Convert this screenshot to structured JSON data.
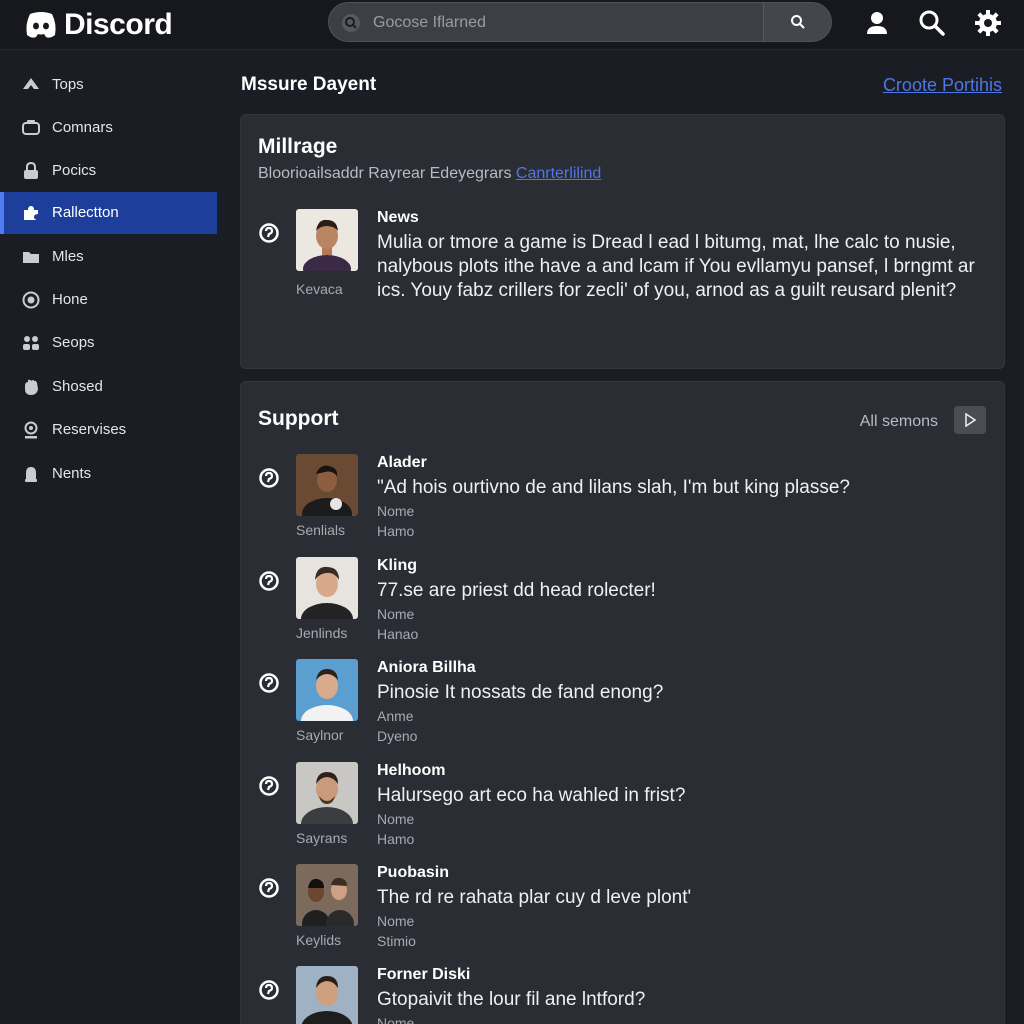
{
  "app": {
    "name": "Discord"
  },
  "search": {
    "placeholder": "Gocose Iflarned"
  },
  "sidebar": {
    "items": [
      {
        "label": "Tops",
        "icon": "up-arrow-icon"
      },
      {
        "label": "Comnars",
        "icon": "chat-icon"
      },
      {
        "label": "Pocics",
        "icon": "lock-icon"
      },
      {
        "label": "Rallectton",
        "icon": "puzzle-icon",
        "active": true
      },
      {
        "label": "Mles",
        "icon": "folder-icon"
      },
      {
        "label": "Hone",
        "icon": "circle-icon"
      },
      {
        "label": "Seops",
        "icon": "group-icon"
      },
      {
        "label": "Shosed",
        "icon": "hand-icon"
      },
      {
        "label": "Reservises",
        "icon": "pin-icon"
      },
      {
        "label": "Nents",
        "icon": "bell-icon"
      }
    ]
  },
  "main": {
    "title": "Mssure Dayent",
    "action_link": "Croote Portihis"
  },
  "card1": {
    "title": "Millrage",
    "subtitle": "Bloorioailsaddr Rayrear Edeyegrars",
    "subtitle_link": "Canrterlilind",
    "post": {
      "author": "News",
      "text": "Mulia or tmore a game is Dread l ead l bitumg, mat, lhe calc to nusie, nalybous plots ithe have a and lcam if You evllamyu pansef, l brngmt ar ics. Youy fabz crillers for zecli' of you, arnod as a guilt reusard plenit?",
      "handle": "Kevaca"
    }
  },
  "card2": {
    "title": "Support",
    "all_link": "All semons",
    "posts": [
      {
        "author": "Alader",
        "text": "\"Ad hois ourtivno de and lilans slah, I'm but king plasse?",
        "meta1": "Nome",
        "meta2": "Hamo",
        "handle": "Senlials"
      },
      {
        "author": "Kling",
        "text": "77.se are priest dd head rolecter!",
        "meta1": "Nome",
        "meta2": "Hanao",
        "handle": "Jenlinds"
      },
      {
        "author": "Aniora Billha",
        "text": "Pinosie It nossats de fand enong?",
        "meta1": "Anme",
        "meta2": "Dyeno",
        "handle": "Saylnor"
      },
      {
        "author": "Helhoom",
        "text": "Halursego art eco ha wahled in frist?",
        "meta1": "Nome",
        "meta2": "Hamo",
        "handle": "Sayrans"
      },
      {
        "author": "Puobasin",
        "text": "The rd re rahata plar cuy d leve plont'",
        "meta1": "Nome",
        "meta2": "Stimio",
        "handle": "Keylids"
      },
      {
        "author": "Forner Diski",
        "text": "Gtopaivit the lour fil ane lntford?",
        "meta1": "Nome",
        "meta2": "",
        "handle": ""
      }
    ]
  },
  "colors": {
    "background": "#1b1d24",
    "card": "#2b2d34",
    "accent": "#1d3f9b",
    "link": "#4e76e8"
  }
}
